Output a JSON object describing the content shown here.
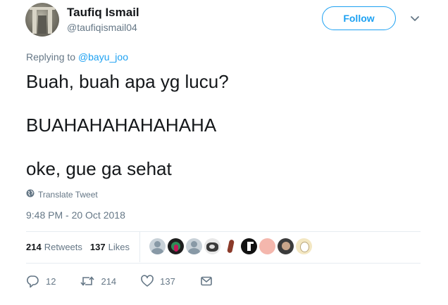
{
  "user": {
    "name": "Taufiq Ismail",
    "handle": "@taufiqismail04"
  },
  "follow_label": "Follow",
  "reply": {
    "prefix": "Replying to",
    "to": "@bayu_joo"
  },
  "tweet": {
    "lines": [
      "Buah, buah apa yg lucu?",
      "BUAHAHAHAHAHAHA",
      "oke, gue ga sehat"
    ]
  },
  "translate_label": "Translate Tweet",
  "timestamp": "9:48 PM - 20 Oct 2018",
  "stats": {
    "retweets_count": "214",
    "retweets_label": "Retweets",
    "likes_count": "137",
    "likes_label": "Likes"
  },
  "actions": {
    "reply_count": "12",
    "retweet_count": "214",
    "like_count": "137"
  },
  "colors": {
    "accent": "#1da1f2",
    "muted": "#657786",
    "text": "#14171a",
    "divider": "#e6ecf0"
  },
  "icons": [
    "chevron-down-icon",
    "globe-icon",
    "reply-icon",
    "retweet-icon",
    "heart-icon",
    "message-icon"
  ]
}
